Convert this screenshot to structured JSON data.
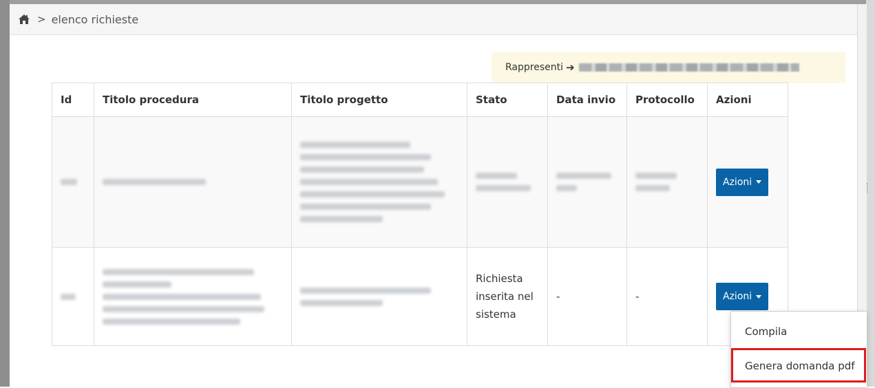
{
  "breadcrumb": {
    "current": "elenco richieste",
    "separator": ">"
  },
  "rappresenti": {
    "label": "Rappresenti",
    "arrow": "➔"
  },
  "table": {
    "headers": [
      "Id",
      "Titolo procedura",
      "Titolo progetto",
      "Stato",
      "Data invio",
      "Protocollo",
      "Azioni"
    ],
    "rows": [
      {
        "stato": "",
        "data_invio": "",
        "protocollo": "",
        "azioni": "Azioni"
      },
      {
        "stato": "Richiesta inserita nel sistema",
        "data_invio": "-",
        "protocollo": "-",
        "azioni": "Azioni"
      }
    ]
  },
  "dropdown": {
    "items": [
      "Compila",
      "Genera domanda pdf"
    ]
  },
  "colors": {
    "accent": "#0a63a6",
    "highlight": "#e01a1a",
    "notice_bg": "#fcf8e3"
  }
}
